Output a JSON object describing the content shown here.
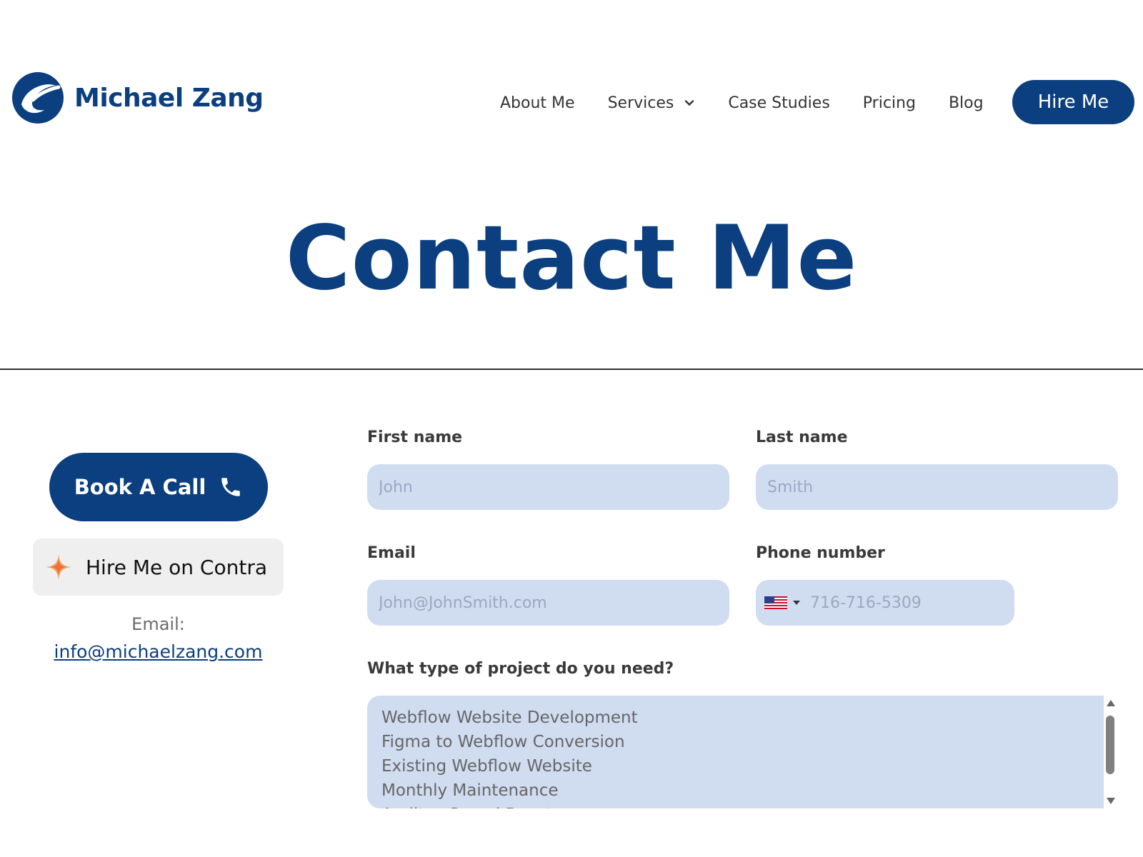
{
  "brand": {
    "name": "Michael Zang",
    "color": "#0b3f7f"
  },
  "nav": {
    "items": [
      {
        "label": "About Me"
      },
      {
        "label": "Services",
        "icon": "chevron-down-icon"
      },
      {
        "label": "Case Studies"
      },
      {
        "label": "Pricing"
      },
      {
        "label": "Blog"
      }
    ],
    "cta_label": "Hire Me"
  },
  "page_title": "Contact Me",
  "sidebar": {
    "book_call_label": "Book A Call",
    "book_call_icon": "phone-icon",
    "contra_label": "Hire Me on Contra",
    "contra_icon": "sparkle-star-icon",
    "email_label": "Email:",
    "email_address": "info@michaelzang.com"
  },
  "form": {
    "first_name": {
      "label": "First name",
      "placeholder": "John",
      "value": ""
    },
    "last_name": {
      "label": "Last name",
      "placeholder": "Smith",
      "value": ""
    },
    "email": {
      "label": "Email",
      "placeholder": "John@JohnSmith.com",
      "value": ""
    },
    "phone": {
      "label": "Phone number",
      "placeholder": "716-716-5309",
      "country_flag": "us-flag-icon",
      "value": ""
    },
    "project_type": {
      "label": "What type of project do you need?",
      "options": [
        "Webflow Website Development",
        "Figma to Webflow Conversion",
        "Existing Webflow Website",
        "Monthly Maintenance",
        "Audit + Speed Boost"
      ]
    },
    "field_color": "#d0dcf0"
  }
}
